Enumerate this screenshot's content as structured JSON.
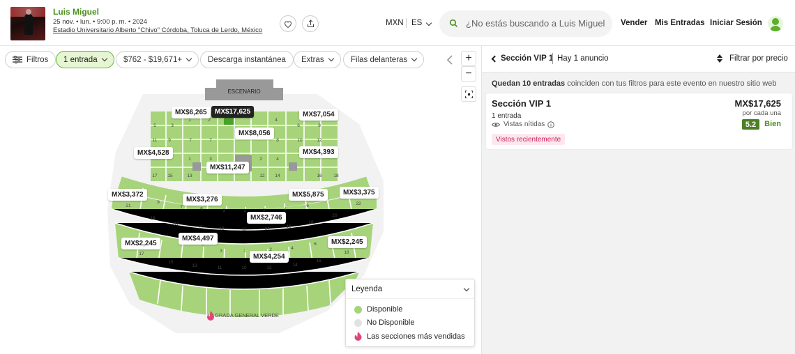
{
  "event": {
    "title": "Luis Miguel",
    "date": "25 nov. • lun. • 9:00 p. m. • 2024",
    "venue": "Estadio Universitario Alberto \"Chivo\" Córdoba, Toluca de Lerdo, México"
  },
  "header": {
    "currency": "MXN",
    "language": "ES",
    "search_placeholder": "¿No estás buscando a Luis Miguel?",
    "links": [
      "Vender",
      "Mis Entradas",
      "Iniciar Sesión"
    ]
  },
  "filters": {
    "filtros": "Filtros",
    "quantity": "1 entrada",
    "price_range": "$762 - $19,671+",
    "instant": "Descarga instantánea",
    "extras": "Extras",
    "front_rows": "Filas delanteras"
  },
  "map": {
    "stage_label": "ESCENARIO",
    "general_label": "GRADA GENERAL VERDE",
    "prices": [
      "MX$6,265",
      "MX$17,625",
      "MX$7,054",
      "MX$8,056",
      "MX$4,528",
      "MX$4,393",
      "MX$11,247",
      "MX$3,372",
      "MX$3,276",
      "MX$5,875",
      "MX$3,375",
      "MX$2,746",
      "MX$2,245",
      "MX$4,497",
      "MX$4,254",
      "MX$2,245"
    ],
    "colors": {
      "available": "#a7d47b",
      "unavailable": "#e2e2e2",
      "selected": "#4aa12a",
      "top_seller": "#e0457b"
    }
  },
  "legend": {
    "title": "Leyenda",
    "available": "Disponible",
    "unavailable": "No Disponible",
    "top": "Las secciones más vendidas"
  },
  "listing": {
    "section": "Sección VIP 1",
    "count": "Hay 1 anuncio",
    "filter_price": "Filtrar por precio",
    "notice_bold": "Quedan 10 entradas",
    "notice_rest": " coinciden con tus filtros para este evento en nuestro sitio web",
    "card": {
      "name": "Sección VIP 1",
      "qty": "1 entrada",
      "view": "Vistas nítidas",
      "badge": "Vistos recientemente",
      "price": "MX$17,625",
      "unit": "por cada una",
      "score": "5.2",
      "rating": "Bien"
    }
  }
}
